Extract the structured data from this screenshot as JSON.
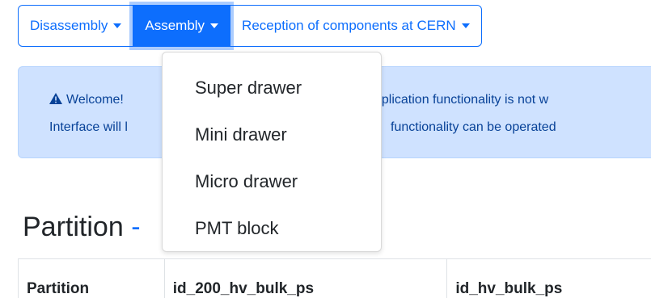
{
  "nav": {
    "buttons": [
      {
        "label": "Disassembly"
      },
      {
        "label": "Assembly"
      },
      {
        "label": "Reception of components at CERN"
      }
    ]
  },
  "dropdown": {
    "items": [
      {
        "label": "Super drawer"
      },
      {
        "label": "Mini drawer"
      },
      {
        "label": "Micro drawer"
      },
      {
        "label": "PMT block"
      }
    ]
  },
  "alert": {
    "line1_left": "Welcome!",
    "line1_right": "pplication functionality is not w",
    "line2_left": "Interface will l",
    "line2_right": "functionality can be operated"
  },
  "section": {
    "title": "Partition",
    "title_suffix": "-"
  },
  "table": {
    "headers": [
      "Partition",
      "id_200_hv_bulk_ps",
      "id_hv_bulk_ps"
    ]
  },
  "colors": {
    "primary": "#0d6efd",
    "alert_bg": "#cfe2ff",
    "alert_text": "#084298"
  }
}
